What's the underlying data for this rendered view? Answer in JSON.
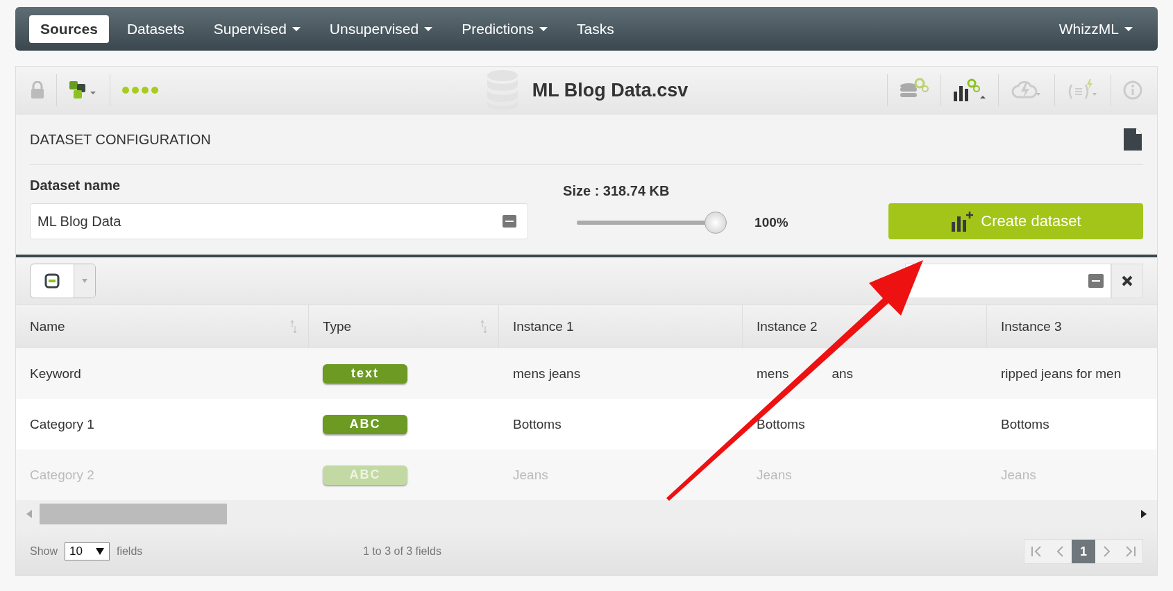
{
  "nav": {
    "items": [
      {
        "label": "Sources",
        "selected": true,
        "dropdown": false
      },
      {
        "label": "Datasets",
        "selected": false,
        "dropdown": false
      },
      {
        "label": "Supervised",
        "selected": false,
        "dropdown": true
      },
      {
        "label": "Unsupervised",
        "selected": false,
        "dropdown": true
      },
      {
        "label": "Predictions",
        "selected": false,
        "dropdown": true
      },
      {
        "label": "Tasks",
        "selected": false,
        "dropdown": false
      }
    ],
    "right": {
      "label": "WhizzML",
      "dropdown": true
    }
  },
  "toolbar": {
    "title": "ML Blog Data.csv"
  },
  "config": {
    "heading": "DATASET CONFIGURATION",
    "name_label": "Dataset name",
    "name_value": "ML Blog Data",
    "size_label": "Size : 318.74 KB",
    "slider": {
      "level": 1.0,
      "reading": "100%"
    },
    "create_button": "Create dataset"
  },
  "table": {
    "columns": [
      "Name",
      "Type",
      "Instance 1",
      "Instance 2",
      "Instance 3"
    ],
    "rows": [
      {
        "cells": [
          "Keyword",
          "text",
          "mens jeans",
          [
            "mens",
            "ans"
          ],
          "ripped jeans for men"
        ],
        "disabled": false
      },
      {
        "cells": [
          "Category 1",
          "ABC",
          "Bottoms",
          "Bottoms",
          "Bottoms"
        ],
        "disabled": false
      },
      {
        "cells": [
          "Category 2",
          "ABC",
          "Jeans",
          "Jeans",
          "Jeans"
        ],
        "disabled": true
      }
    ]
  },
  "footer": {
    "show": "Show",
    "per_page": "10",
    "fields": "fields",
    "summary": "1 to 3 of 3 fields",
    "pages": [
      {
        "label": "1",
        "selected": true
      }
    ]
  }
}
